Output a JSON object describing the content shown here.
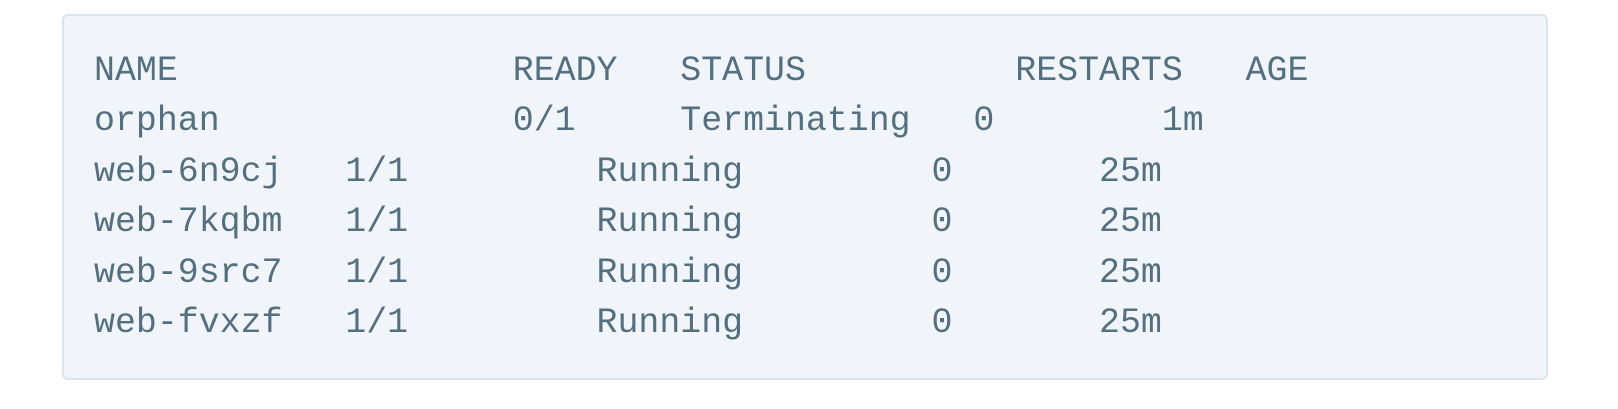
{
  "terminal": {
    "lines": [
      "NAME                READY   STATUS          RESTARTS   AGE",
      "orphan              0/1     Terminating   0        1m",
      "web-6n9cj   1/1         Running         0       25m",
      "web-7kqbm   1/1         Running         0       25m",
      "web-9src7   1/1         Running         0       25m",
      "web-fvxzf   1/1         Running         0       25m"
    ]
  }
}
